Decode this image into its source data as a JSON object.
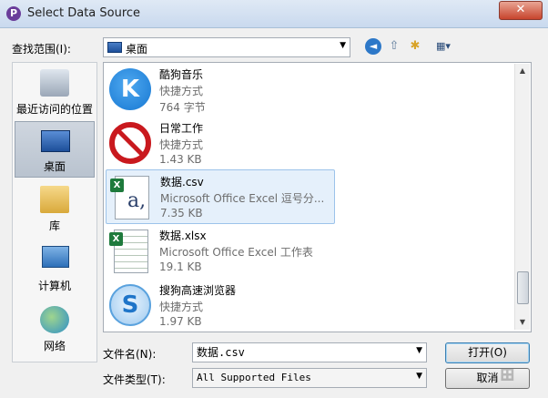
{
  "window": {
    "app_icon_letter": "P",
    "title": "Select Data Source",
    "close_glyph": "✕"
  },
  "lookin": {
    "label": "查找范围(I):",
    "value": "桌面"
  },
  "toolbar_icons": [
    "back-icon",
    "up-folder-icon",
    "new-folder-icon",
    "view-menu-icon"
  ],
  "places": [
    {
      "label": "最近访问的位置",
      "icon": "recent-places-icon",
      "selected": false
    },
    {
      "label": "桌面",
      "icon": "desktop-icon",
      "selected": true
    },
    {
      "label": "库",
      "icon": "libraries-icon",
      "selected": false
    },
    {
      "label": "计算机",
      "icon": "computer-icon",
      "selected": false
    },
    {
      "label": "网络",
      "icon": "network-icon",
      "selected": false
    }
  ],
  "files": [
    {
      "name": "酷狗音乐",
      "type": "快捷方式",
      "size": "764 字节",
      "icon": "kugou-icon",
      "selected": false
    },
    {
      "name": "日常工作",
      "type": "快捷方式",
      "size": "1.43 KB",
      "icon": "prohibited-icon",
      "selected": false
    },
    {
      "name": "数据.csv",
      "type": "Microsoft Office Excel 逗号分...",
      "size": "7.35 KB",
      "icon": "csv-file-icon",
      "selected": true
    },
    {
      "name": "数据.xlsx",
      "type": "Microsoft Office Excel 工作表",
      "size": "19.1 KB",
      "icon": "xlsx-file-icon",
      "selected": false
    },
    {
      "name": "搜狗高速浏览器",
      "type": "快捷方式",
      "size": "1.97 KB",
      "icon": "sogou-browser-icon",
      "selected": false
    }
  ],
  "filename": {
    "label": "文件名(N):",
    "value": "数据.csv"
  },
  "filetype": {
    "label": "文件类型(T):",
    "value": "All Supported Files"
  },
  "buttons": {
    "open": "打开(O)",
    "cancel": "取消"
  },
  "colors": {
    "selection_bg": "#e5f0fb",
    "selection_border": "#9cc3ea",
    "close_button": "#c7442d",
    "excel_green": "#1e7a3c"
  }
}
